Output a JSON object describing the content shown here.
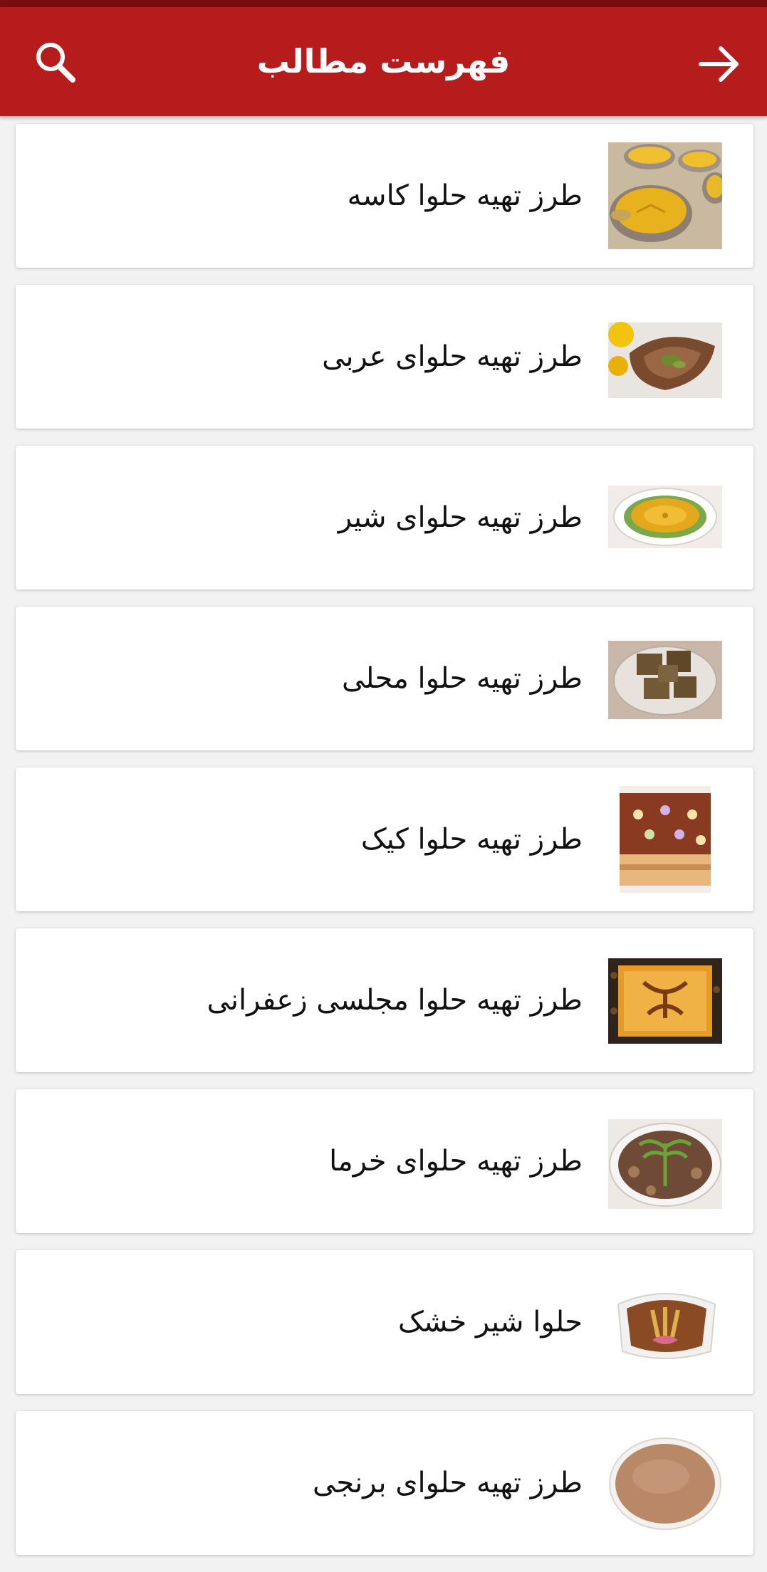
{
  "app_bar": {
    "title": "فهرست مطالب",
    "search_icon": "search-icon",
    "back_icon": "arrow-right-icon",
    "color": "#b71c1c"
  },
  "items": [
    {
      "title": "طرز تهیه حلوا کاسه",
      "thumb": "halva-bowls-image"
    },
    {
      "title": "طرز تهیه حلوای عربی",
      "thumb": "arabic-halva-image"
    },
    {
      "title": "طرز تهیه حلوای شیر",
      "thumb": "milk-halva-image"
    },
    {
      "title": "طرز تهیه حلوا محلی",
      "thumb": "local-halva-image"
    },
    {
      "title": "طرز تهیه حلوا کیک",
      "thumb": "halva-cake-image"
    },
    {
      "title": "طرز تهیه حلوا مجلسی زعفرانی",
      "thumb": "saffron-halva-image"
    },
    {
      "title": "طرز تهیه حلوای خرما",
      "thumb": "date-halva-image"
    },
    {
      "title": "حلوا شیر خشک",
      "thumb": "powdered-milk-halva-image"
    },
    {
      "title": "طرز تهیه حلوای برنجی",
      "thumb": "rice-halva-image"
    }
  ]
}
